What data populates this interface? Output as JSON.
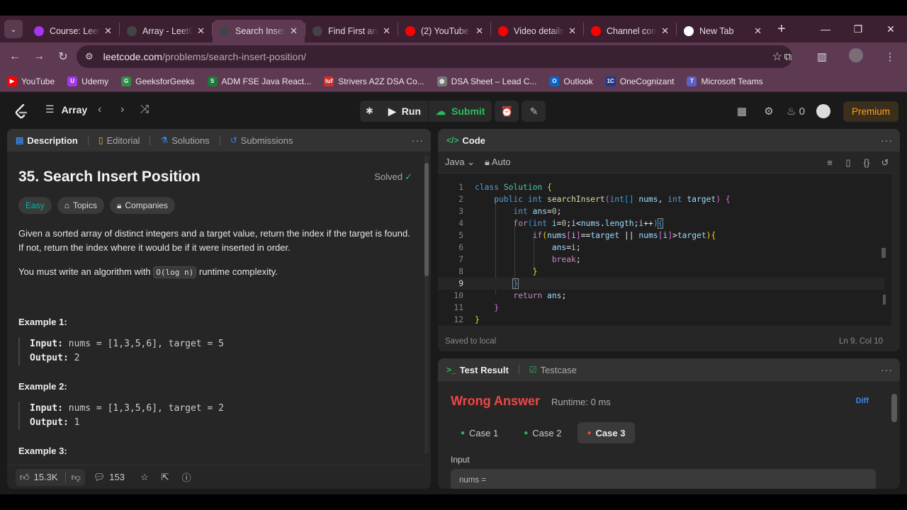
{
  "browser": {
    "tabs": [
      {
        "title": "Course: LeetCode",
        "favicon": "udemy-icon",
        "color": "#a435f0"
      },
      {
        "title": "Array - LeetCode",
        "favicon": "leetcode-icon",
        "color": "#444444"
      },
      {
        "title": "Search Insert Position",
        "favicon": "leetcode-icon",
        "color": "#444444",
        "active": true
      },
      {
        "title": "Find First and Last",
        "favicon": "leetcode-icon",
        "color": "#444444"
      },
      {
        "title": "(2) YouTube",
        "favicon": "youtube-icon",
        "color": "#ff0000"
      },
      {
        "title": "Video details",
        "favicon": "youtube-studio-icon",
        "color": "#ff0000"
      },
      {
        "title": "Channel content",
        "favicon": "youtube-studio-icon",
        "color": "#ff0000"
      },
      {
        "title": "New Tab",
        "favicon": "chrome-icon",
        "color": "#ffffff"
      }
    ],
    "url_host": "leetcode.com",
    "url_path": "/problems/search-insert-position/",
    "bookmarks": [
      {
        "label": "YouTube",
        "color": "#ff0000",
        "glyph": "▶"
      },
      {
        "label": "Udemy",
        "color": "#a435f0",
        "glyph": "U"
      },
      {
        "label": "GeeksforGeeks",
        "color": "#2f8d46",
        "glyph": "G"
      },
      {
        "label": "ADM FSE Java React...",
        "color": "#1b7a3a",
        "glyph": "S"
      },
      {
        "label": "Strivers A2Z DSA Co...",
        "color": "#d32f2f",
        "glyph": "tuf"
      },
      {
        "label": "DSA Sheet – Lead C...",
        "color": "#777777",
        "glyph": "◍"
      },
      {
        "label": "Outlook",
        "color": "#0a64c8",
        "glyph": "O"
      },
      {
        "label": "OneCognizant",
        "color": "#1e3a8a",
        "glyph": "1C"
      },
      {
        "label": "Microsoft Teams",
        "color": "#5b5fc7",
        "glyph": "T"
      }
    ]
  },
  "leetcode": {
    "problem_list": "Array",
    "run_label": "Run",
    "submit_label": "Submit",
    "fire_count": "0",
    "premium_label": "Premium"
  },
  "description": {
    "tabs": [
      "Description",
      "Editorial",
      "Solutions",
      "Submissions"
    ],
    "title": "35. Search Insert Position",
    "status": "Solved",
    "difficulty": "Easy",
    "topics_label": "Topics",
    "companies_label": "Companies",
    "para1": "Given a sorted array of distinct integers and a target value, return the index if the target is found. If not, return the index where it would be if it were inserted in order.",
    "para2_before": "You must write an algorithm with ",
    "para2_code": "O(log n)",
    "para2_after": " runtime complexity.",
    "examples": [
      {
        "heading": "Example 1:",
        "input": "nums = [1,3,5,6], target = 5",
        "output": "2"
      },
      {
        "heading": "Example 2:",
        "input": "nums = [1,3,5,6], target = 2",
        "output": "1"
      },
      {
        "heading": "Example 3:"
      }
    ],
    "input_label": "Input:",
    "output_label": "Output:",
    "likes": "15.3K",
    "comments": "153"
  },
  "code": {
    "tab_label": "Code",
    "language": "Java",
    "auto_label": "Auto",
    "saved_status": "Saved to local",
    "cursor_pos": "Ln 9, Col 10",
    "line_numbers": [
      "1",
      "2",
      "3",
      "4",
      "5",
      "6",
      "7",
      "8",
      "9",
      "10",
      "11",
      "12"
    ]
  },
  "test": {
    "result_tab": "Test Result",
    "testcase_tab": "Testcase",
    "verdict": "Wrong Answer",
    "runtime": "Runtime: 0 ms",
    "diff_label": "Diff",
    "cases": [
      "Case 1",
      "Case 2",
      "Case 3"
    ],
    "input_label": "Input",
    "nums_label": "nums ="
  }
}
